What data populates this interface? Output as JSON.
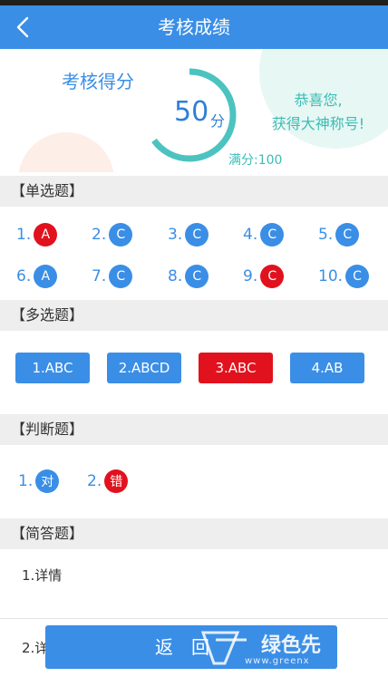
{
  "header": {
    "title": "考核成绩"
  },
  "score": {
    "label": "考核得分",
    "value": "50",
    "unit": "分",
    "full_score": "满分:100",
    "progress": 0.5,
    "congrats_line1": "恭喜您,",
    "congrats_line2": "获得大神称号!"
  },
  "sections": {
    "single": "【单选题】",
    "multi": "【多选题】",
    "judge": "【判断题】",
    "short": "【简答题】"
  },
  "single_choice": [
    {
      "num": "1.",
      "answer": "A",
      "status": "wrong"
    },
    {
      "num": "2.",
      "answer": "C",
      "status": "right"
    },
    {
      "num": "3.",
      "answer": "C",
      "status": "right"
    },
    {
      "num": "4.",
      "answer": "C",
      "status": "right"
    },
    {
      "num": "5.",
      "answer": "C",
      "status": "right"
    },
    {
      "num": "6.",
      "answer": "A",
      "status": "right"
    },
    {
      "num": "7.",
      "answer": "C",
      "status": "right"
    },
    {
      "num": "8.",
      "answer": "C",
      "status": "right"
    },
    {
      "num": "9.",
      "answer": "C",
      "status": "wrong"
    },
    {
      "num": "10.",
      "answer": "C",
      "status": "right"
    }
  ],
  "multi_choice": [
    {
      "label": "1.ABC",
      "status": "right"
    },
    {
      "label": "2.ABCD",
      "status": "right"
    },
    {
      "label": "3.ABC",
      "status": "wrong"
    },
    {
      "label": "4.AB",
      "status": "right"
    }
  ],
  "judge": [
    {
      "num": "1.",
      "answer": "对",
      "status": "right"
    },
    {
      "num": "2.",
      "answer": "错",
      "status": "wrong"
    }
  ],
  "short_answer": [
    "1.详情",
    "2.详"
  ],
  "footer": {
    "return_label": "返回"
  },
  "watermark": {
    "text": "绿色先",
    "sub": "www.greenx"
  },
  "colors": {
    "primary": "#3a8ee6",
    "wrong": "#e1121e",
    "accent": "#3cbcb4"
  }
}
